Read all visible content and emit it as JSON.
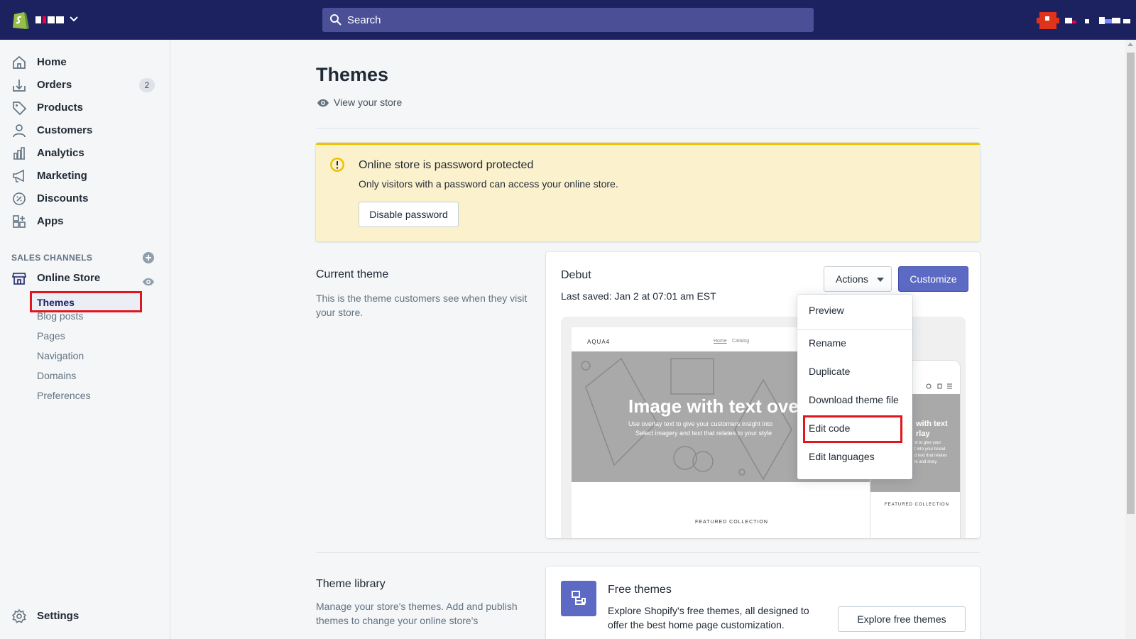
{
  "topbar": {
    "search_placeholder": "Search",
    "accent_color": "#1c2260"
  },
  "sidebar": {
    "items": [
      {
        "label": "Home",
        "icon": "home-icon"
      },
      {
        "label": "Orders",
        "icon": "orders-icon",
        "badge": "2"
      },
      {
        "label": "Products",
        "icon": "tag-icon"
      },
      {
        "label": "Customers",
        "icon": "person-icon"
      },
      {
        "label": "Analytics",
        "icon": "bar-chart-icon"
      },
      {
        "label": "Marketing",
        "icon": "megaphone-icon"
      },
      {
        "label": "Discounts",
        "icon": "discount-icon"
      },
      {
        "label": "Apps",
        "icon": "apps-icon"
      }
    ],
    "sales_channels_title": "SALES CHANNELS",
    "online_store_label": "Online Store",
    "sub_items": [
      "Themes",
      "Blog posts",
      "Pages",
      "Navigation",
      "Domains",
      "Preferences"
    ],
    "settings_label": "Settings"
  },
  "main": {
    "page_title": "Themes",
    "view_store": "View your store",
    "banner": {
      "title": "Online store is password protected",
      "text": "Only visitors with a password can access your online store.",
      "button": "Disable password",
      "color": "#fcf1cd"
    },
    "current": {
      "title": "Current theme",
      "description": "This is the theme customers see when they visit your store."
    },
    "theme": {
      "name": "Debut",
      "saved": "Last saved: Jan 2 at 07:01 am EST",
      "actions_label": "Actions",
      "customize_label": "Customize",
      "preview": {
        "logo": "AQUA4",
        "nav_home": "Home",
        "nav_catalog": "Catalog",
        "hero_title": "Image with text ove",
        "hero_sub1": "Use overlay text to give your customers insight into",
        "hero_sub2": "Select imagery and text that relates to your style",
        "featured": "FEATURED COLLECTION",
        "mobile_hero_title": "with text\nrlay",
        "mobile_hero_sub": "xt to give your\nt into your brand.\nd text that relates\nle and story.",
        "mobile_featured": "FEATURED COLLECTION"
      }
    },
    "dropdown": [
      "Preview",
      "Rename",
      "Duplicate",
      "Download theme file",
      "Edit code",
      "Edit languages"
    ],
    "library": {
      "title": "Theme library",
      "description": "Manage your store's themes. Add and publish themes to change your online store's"
    },
    "free_themes": {
      "title": "Free themes",
      "description": "Explore Shopify's free themes, all designed to offer the best home page customization.",
      "button": "Explore free themes"
    }
  },
  "colors": {
    "highlight": "#e0161c",
    "primary_button": "#5c6ac4"
  }
}
